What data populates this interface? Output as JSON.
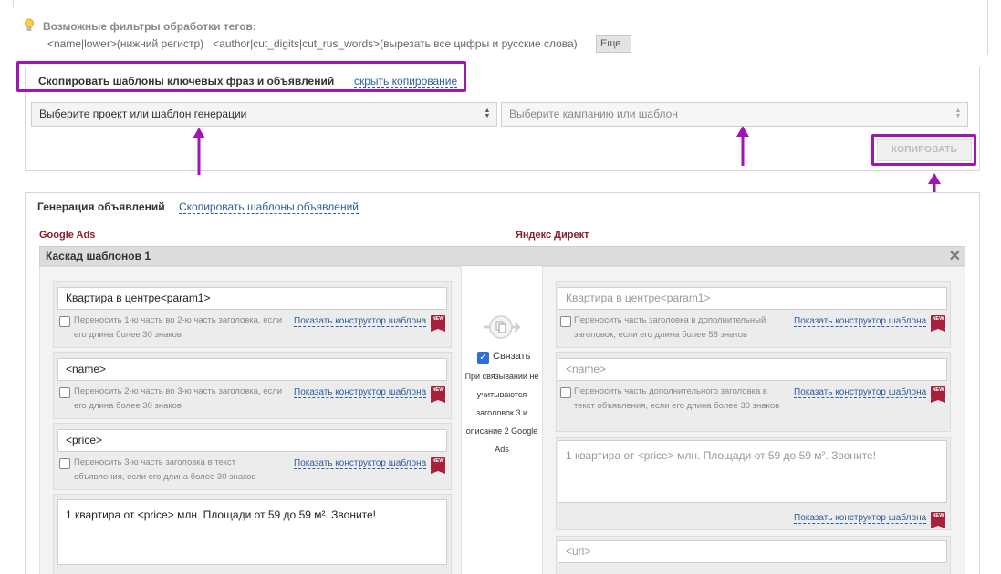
{
  "filters": {
    "title": "Возможные фильтры обработки тегов:",
    "line": "<name|lower>(нижний регистр)   <author|cut_digits|cut_rus_words>(вырезать все цифры и русские слова)",
    "more_label": "Еще.."
  },
  "copy": {
    "header": "Скопировать шаблоны ключевых фраз и объявлений",
    "hide_link": "скрыть копирование",
    "project_select": "Выберите проект или шаблон генерации",
    "campaign_select": "Выберите кампанию или шаблон",
    "copy_button": "КОПИРОВАТЬ"
  },
  "generation": {
    "header": "Генерация объявлений",
    "copy_link": "Скопировать шаблоны объявлений",
    "google_label": "Google Ads",
    "yandex_label": "Яндекс Директ",
    "cascade_title": "Каскад шаблонов 1",
    "constructor_link": "Показать конструктор шаблона",
    "new_badge": "NEW",
    "google": {
      "headline1": "Квартира в центре<param1>",
      "hint1": "Переносить 1-ю часть во 2-ю часть заголовка, если его длина более 30 знаков",
      "headline2": "<name>",
      "hint2": "Переносить 2-ю часть во 3-ю часть заголовка, если его длина более 30 знаков",
      "headline3": "<price>",
      "hint3": "Переносить 3-ю часть заголовка в текст объявления, если его длина более 30 знаков",
      "description": "1 квартира от <price> млн. Площади от 59 до 59 м². Звоните!"
    },
    "middle": {
      "link_label": "Связать",
      "note": "При связывании не учитываются заголовок 3 и описание 2 Google Ads"
    },
    "yandex": {
      "headline1": "Квартира в центре<param1>",
      "hint1": "Переносить часть заголовка в дополнительный заголовок, если его длина более 56 знаков",
      "headline2": "<name>",
      "hint2": "Переносить часть дополнительного заголовка в текст объявления, если его длина более 30 знаков",
      "description": "1 квартира от <price> млн. Площади от 59 до 59 м². Звоните!",
      "url": "<url>"
    }
  },
  "colors": {
    "highlight": "#a314b4",
    "link": "#2a5f9e",
    "brand_label": "#8a1f2a",
    "new_badge": "#a8203a"
  }
}
